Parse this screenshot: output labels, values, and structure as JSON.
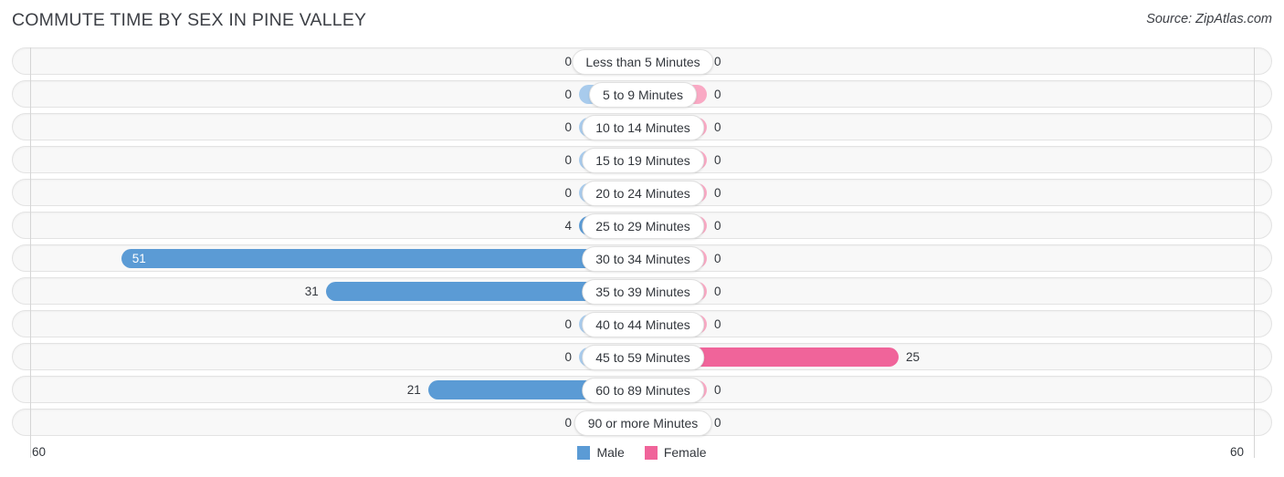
{
  "header": {
    "title": "COMMUTE TIME BY SEX IN PINE VALLEY",
    "source": "Source: ZipAtlas.com"
  },
  "axis": {
    "left_tick": "60",
    "right_tick": "60"
  },
  "legend": {
    "items": [
      {
        "label": "Male",
        "color": "#5b9bd5"
      },
      {
        "label": "Female",
        "color": "#f0649a"
      }
    ]
  },
  "colors": {
    "male_strong": "#5b9bd5",
    "male_light": "#a8cbec",
    "female_strong": "#f0649a",
    "female_light": "#f9a9c4",
    "row_background": "#f8f8f8",
    "row_border": "#e3e3e3",
    "text": "#33373d"
  },
  "chart_data": {
    "type": "bar",
    "title": "COMMUTE TIME BY SEX IN PINE VALLEY",
    "xlabel": "",
    "ylabel": "",
    "orientation": "horizontal-diverging",
    "xlim": [
      60,
      60
    ],
    "grid": false,
    "legend_position": "bottom-center",
    "categories": [
      "Less than 5 Minutes",
      "5 to 9 Minutes",
      "10 to 14 Minutes",
      "15 to 19 Minutes",
      "20 to 24 Minutes",
      "25 to 29 Minutes",
      "30 to 34 Minutes",
      "35 to 39 Minutes",
      "40 to 44 Minutes",
      "45 to 59 Minutes",
      "60 to 89 Minutes",
      "90 or more Minutes"
    ],
    "series": [
      {
        "name": "Male",
        "values": [
          0,
          0,
          0,
          0,
          0,
          4,
          51,
          31,
          0,
          0,
          21,
          0
        ]
      },
      {
        "name": "Female",
        "values": [
          0,
          0,
          0,
          0,
          0,
          0,
          0,
          0,
          0,
          25,
          0,
          0
        ]
      }
    ]
  }
}
